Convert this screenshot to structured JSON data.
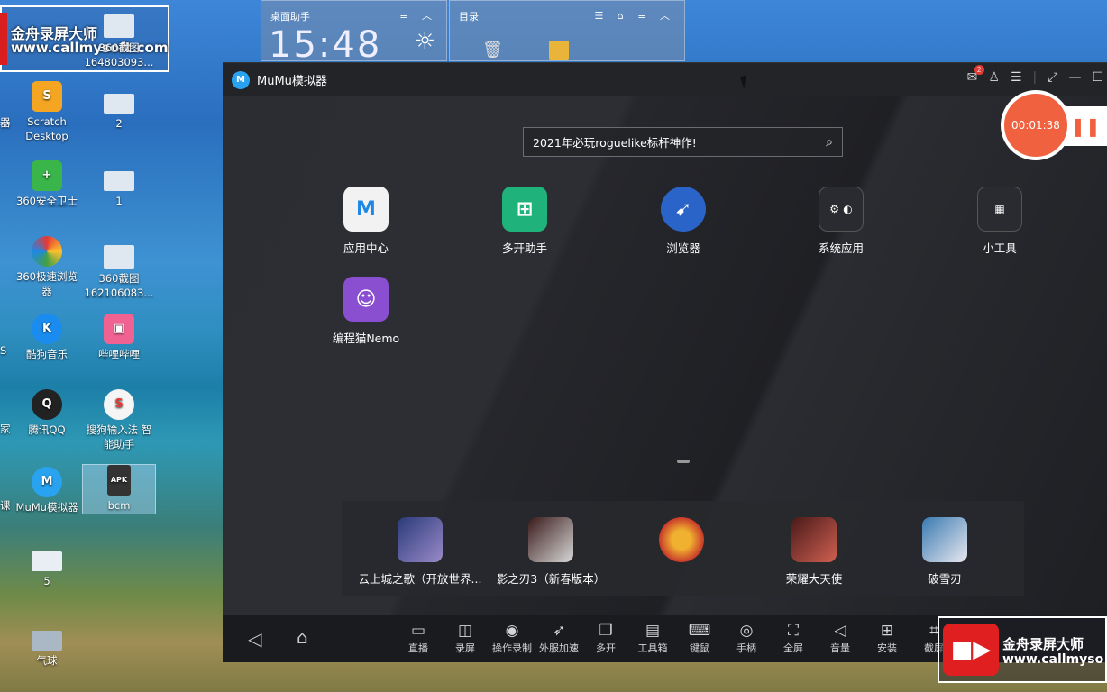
{
  "watermark": {
    "line1": "金舟录屏大师",
    "line2": "www.callmysoft.com",
    "line2_short": "www.callmyso"
  },
  "desktop": {
    "icons": [
      {
        "label": "",
        "icon": "app-tile-icon"
      },
      {
        "label": "360截图\n164803093...",
        "icon": "screenshot-file-icon"
      },
      {
        "label": "Scratch\nDesktop",
        "icon": "scratch-icon"
      },
      {
        "label": "2",
        "icon": "image-file-icon"
      },
      {
        "label": "360安全卫士",
        "icon": "360-security-icon"
      },
      {
        "label": "1",
        "icon": "image-file-icon"
      },
      {
        "label": "360极速浏览\n器",
        "icon": "360-browser-icon"
      },
      {
        "label": "360截图\n162106083...",
        "icon": "screenshot-file-icon"
      },
      {
        "label": "酷狗音乐",
        "icon": "kugou-icon"
      },
      {
        "label": "哔哩哔哩",
        "icon": "bilibili-icon"
      },
      {
        "label": "腾讯QQ",
        "icon": "qq-icon"
      },
      {
        "label": "搜狗输入法 智\n能助手",
        "icon": "sogou-icon"
      },
      {
        "label": "MuMu模拟器",
        "icon": "mumu-icon"
      },
      {
        "label": "bcm",
        "icon": "apk-icon"
      },
      {
        "label": "5",
        "icon": "image-file-icon"
      },
      {
        "label": "气球",
        "icon": "image-file-icon"
      }
    ],
    "left_clipped": [
      "器",
      "S",
      "家",
      "课"
    ]
  },
  "fences": {
    "assistant": {
      "title": "桌面助手",
      "time": "15:48"
    },
    "directory": {
      "title": "目录"
    }
  },
  "mumu": {
    "title": "MuMu模拟器",
    "mail_badge": "2",
    "search_placeholder": "2021年必玩roguelike标杆神作!",
    "apps": [
      {
        "label": "应用中心",
        "icon": "app-center-icon"
      },
      {
        "label": "多开助手",
        "icon": "multi-open-icon"
      },
      {
        "label": "浏览器",
        "icon": "compass-icon"
      },
      {
        "label": "系统应用",
        "icon": "system-apps-icon"
      },
      {
        "label": "小工具",
        "icon": "tools-icon"
      },
      {
        "label": "编程猫Nemo",
        "icon": "nemo-icon"
      }
    ],
    "dock": [
      {
        "label": "云上城之歌（开放世界...",
        "color": "#4a5a9a"
      },
      {
        "label": "影之刃3（新春版本）",
        "color": "#6b2a2a"
      },
      {
        "label": "",
        "color": "#c83a2a"
      },
      {
        "label": "荣耀大天使",
        "color": "#8a3a2a"
      },
      {
        "label": "破雪刃",
        "color": "#4a7aa8"
      }
    ],
    "toolbar": [
      {
        "label": "直播",
        "icon": "tv-icon",
        "glyph": "▭"
      },
      {
        "label": "录屏",
        "icon": "video-camera-icon",
        "glyph": "◫"
      },
      {
        "label": "操作录制",
        "icon": "record-action-icon",
        "glyph": "◉"
      },
      {
        "label": "外服加速",
        "icon": "rocket-icon",
        "glyph": "➶"
      },
      {
        "label": "多开",
        "icon": "copy-icon",
        "glyph": "❐"
      },
      {
        "label": "工具箱",
        "icon": "toolbox-icon",
        "glyph": "▤"
      },
      {
        "label": "键鼠",
        "icon": "keyboard-icon",
        "glyph": "⌨"
      },
      {
        "label": "手柄",
        "icon": "gamepad-icon",
        "glyph": "◎"
      },
      {
        "label": "全屏",
        "icon": "fullscreen-icon",
        "glyph": "⛶"
      },
      {
        "label": "音量",
        "icon": "mute-icon",
        "glyph": "◁"
      },
      {
        "label": "安装",
        "icon": "apk-install-icon",
        "glyph": "⊞"
      },
      {
        "label": "截屏",
        "icon": "crop-icon",
        "glyph": "⌗"
      }
    ]
  },
  "recorder": {
    "elapsed": "00:01:38",
    "pause_glyph": "❚❚"
  }
}
